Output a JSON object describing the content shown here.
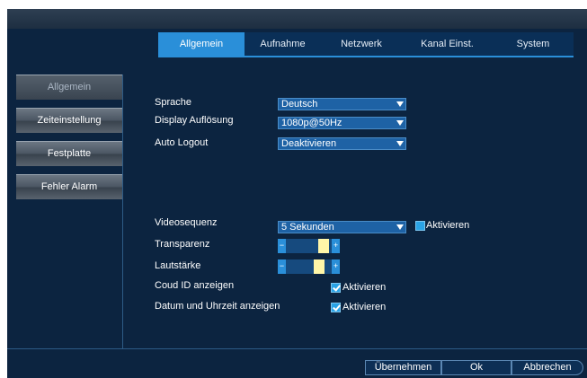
{
  "tabs": [
    {
      "label": "Allgemein",
      "active": true
    },
    {
      "label": "Aufnahme",
      "active": false
    },
    {
      "label": "Netzwerk",
      "active": false
    },
    {
      "label": "Kanal Einst.",
      "active": false
    },
    {
      "label": "System",
      "active": false
    }
  ],
  "sidebar": {
    "items": [
      {
        "label": "Allgemein",
        "active": true
      },
      {
        "label": "Zeiteinstellung",
        "active": false
      },
      {
        "label": "Festplatte",
        "active": false
      },
      {
        "label": "Fehler Alarm",
        "active": false
      }
    ]
  },
  "settings": {
    "language": {
      "label": "Sprache",
      "value": "Deutsch"
    },
    "resolution": {
      "label": "Display Auflösung",
      "value": "1080p@50Hz"
    },
    "autologout": {
      "label": "Auto Logout",
      "value": "Deaktivieren"
    },
    "sequence": {
      "label": "Videosequenz",
      "value": "5 Sekunden",
      "checkbox_label": "Aktivieren",
      "checked": false
    },
    "transparency": {
      "label": "Transparenz",
      "level": 0.92
    },
    "volume": {
      "label": "Lautstärke",
      "level": 0.8
    },
    "cloud_id": {
      "label": "Coud ID anzeigen",
      "checkbox_label": "Aktivieren",
      "checked": true
    },
    "datetime": {
      "label": "Datum und Uhrzeit anzeigen",
      "checkbox_label": "Aktivieren",
      "checked": true
    }
  },
  "buttons": {
    "apply": "Übernehmen",
    "ok": "Ok",
    "cancel": "Abbrechen"
  },
  "colors": {
    "background": "#0c2440",
    "accent": "#2a8fd9",
    "select": "#1e62a5",
    "knob": "#fff6a8"
  }
}
